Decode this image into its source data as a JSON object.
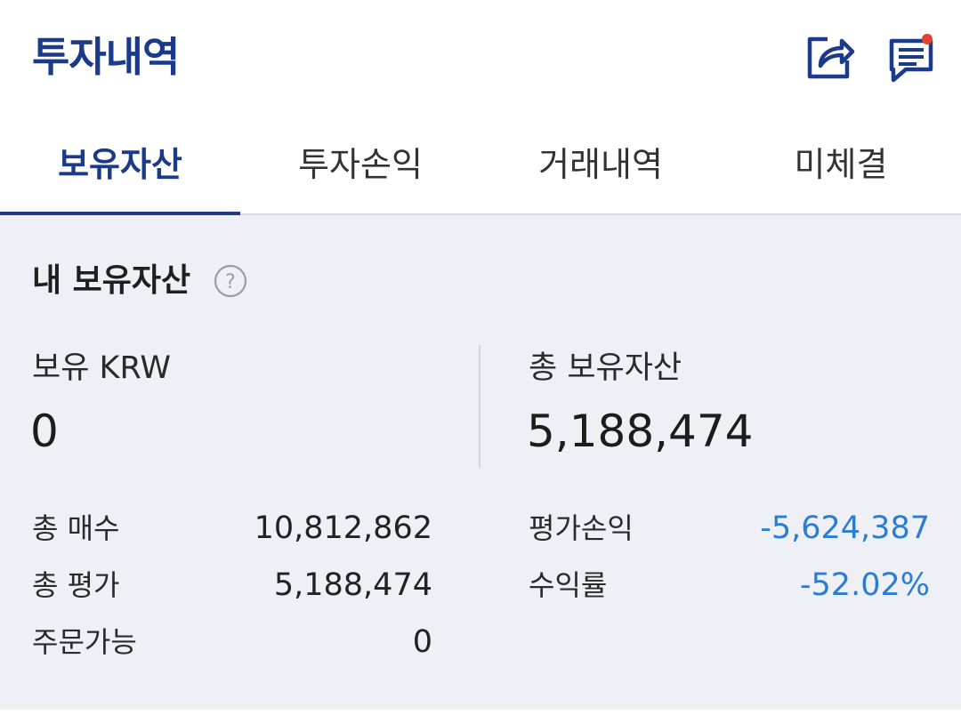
{
  "header": {
    "title": "투자내역",
    "icons": [
      "share-icon",
      "notice-icon"
    ],
    "notice_dot_color": "#e0442f",
    "accent_color": "#1b3a8a"
  },
  "tabs": [
    {
      "label": "보유자산",
      "active": true
    },
    {
      "label": "투자손익",
      "active": false
    },
    {
      "label": "거래내역",
      "active": false
    },
    {
      "label": "미체결",
      "active": false
    }
  ],
  "holdings": {
    "section_title": "내 보유자산",
    "help_symbol": "?",
    "krw_label": "보유 KRW",
    "krw_value": "0",
    "total_label": "총 보유자산",
    "total_value": "5,188,474",
    "rows_left": [
      {
        "label": "총 매수",
        "value": "10,812,862"
      },
      {
        "label": "총 평가",
        "value": "5,188,474"
      },
      {
        "label": "주문가능",
        "value": "0"
      }
    ],
    "rows_right": [
      {
        "label": "평가손익",
        "value": "-5,624,387"
      },
      {
        "label": "수익률",
        "value": "-52.02%"
      }
    ],
    "negative_color": "#2b7cd3"
  }
}
